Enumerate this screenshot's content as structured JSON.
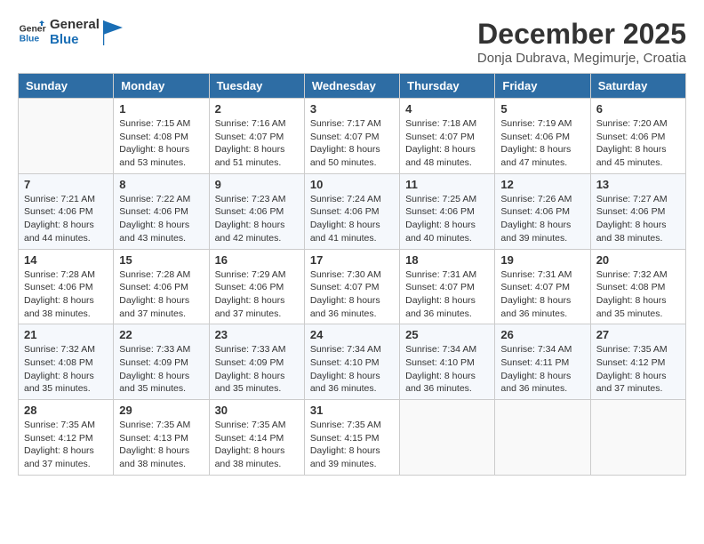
{
  "header": {
    "logo_general": "General",
    "logo_blue": "Blue",
    "month_year": "December 2025",
    "location": "Donja Dubrava, Megimurje, Croatia"
  },
  "weekdays": [
    "Sunday",
    "Monday",
    "Tuesday",
    "Wednesday",
    "Thursday",
    "Friday",
    "Saturday"
  ],
  "weeks": [
    [
      {
        "day": "",
        "sunrise": "",
        "sunset": "",
        "daylight": ""
      },
      {
        "day": "1",
        "sunrise": "7:15 AM",
        "sunset": "4:08 PM",
        "daylight": "8 hours and 53 minutes."
      },
      {
        "day": "2",
        "sunrise": "7:16 AM",
        "sunset": "4:07 PM",
        "daylight": "8 hours and 51 minutes."
      },
      {
        "day": "3",
        "sunrise": "7:17 AM",
        "sunset": "4:07 PM",
        "daylight": "8 hours and 50 minutes."
      },
      {
        "day": "4",
        "sunrise": "7:18 AM",
        "sunset": "4:07 PM",
        "daylight": "8 hours and 48 minutes."
      },
      {
        "day": "5",
        "sunrise": "7:19 AM",
        "sunset": "4:06 PM",
        "daylight": "8 hours and 47 minutes."
      },
      {
        "day": "6",
        "sunrise": "7:20 AM",
        "sunset": "4:06 PM",
        "daylight": "8 hours and 45 minutes."
      }
    ],
    [
      {
        "day": "7",
        "sunrise": "7:21 AM",
        "sunset": "4:06 PM",
        "daylight": "8 hours and 44 minutes."
      },
      {
        "day": "8",
        "sunrise": "7:22 AM",
        "sunset": "4:06 PM",
        "daylight": "8 hours and 43 minutes."
      },
      {
        "day": "9",
        "sunrise": "7:23 AM",
        "sunset": "4:06 PM",
        "daylight": "8 hours and 42 minutes."
      },
      {
        "day": "10",
        "sunrise": "7:24 AM",
        "sunset": "4:06 PM",
        "daylight": "8 hours and 41 minutes."
      },
      {
        "day": "11",
        "sunrise": "7:25 AM",
        "sunset": "4:06 PM",
        "daylight": "8 hours and 40 minutes."
      },
      {
        "day": "12",
        "sunrise": "7:26 AM",
        "sunset": "4:06 PM",
        "daylight": "8 hours and 39 minutes."
      },
      {
        "day": "13",
        "sunrise": "7:27 AM",
        "sunset": "4:06 PM",
        "daylight": "8 hours and 38 minutes."
      }
    ],
    [
      {
        "day": "14",
        "sunrise": "7:28 AM",
        "sunset": "4:06 PM",
        "daylight": "8 hours and 38 minutes."
      },
      {
        "day": "15",
        "sunrise": "7:28 AM",
        "sunset": "4:06 PM",
        "daylight": "8 hours and 37 minutes."
      },
      {
        "day": "16",
        "sunrise": "7:29 AM",
        "sunset": "4:06 PM",
        "daylight": "8 hours and 37 minutes."
      },
      {
        "day": "17",
        "sunrise": "7:30 AM",
        "sunset": "4:07 PM",
        "daylight": "8 hours and 36 minutes."
      },
      {
        "day": "18",
        "sunrise": "7:31 AM",
        "sunset": "4:07 PM",
        "daylight": "8 hours and 36 minutes."
      },
      {
        "day": "19",
        "sunrise": "7:31 AM",
        "sunset": "4:07 PM",
        "daylight": "8 hours and 36 minutes."
      },
      {
        "day": "20",
        "sunrise": "7:32 AM",
        "sunset": "4:08 PM",
        "daylight": "8 hours and 35 minutes."
      }
    ],
    [
      {
        "day": "21",
        "sunrise": "7:32 AM",
        "sunset": "4:08 PM",
        "daylight": "8 hours and 35 minutes."
      },
      {
        "day": "22",
        "sunrise": "7:33 AM",
        "sunset": "4:09 PM",
        "daylight": "8 hours and 35 minutes."
      },
      {
        "day": "23",
        "sunrise": "7:33 AM",
        "sunset": "4:09 PM",
        "daylight": "8 hours and 35 minutes."
      },
      {
        "day": "24",
        "sunrise": "7:34 AM",
        "sunset": "4:10 PM",
        "daylight": "8 hours and 36 minutes."
      },
      {
        "day": "25",
        "sunrise": "7:34 AM",
        "sunset": "4:10 PM",
        "daylight": "8 hours and 36 minutes."
      },
      {
        "day": "26",
        "sunrise": "7:34 AM",
        "sunset": "4:11 PM",
        "daylight": "8 hours and 36 minutes."
      },
      {
        "day": "27",
        "sunrise": "7:35 AM",
        "sunset": "4:12 PM",
        "daylight": "8 hours and 37 minutes."
      }
    ],
    [
      {
        "day": "28",
        "sunrise": "7:35 AM",
        "sunset": "4:12 PM",
        "daylight": "8 hours and 37 minutes."
      },
      {
        "day": "29",
        "sunrise": "7:35 AM",
        "sunset": "4:13 PM",
        "daylight": "8 hours and 38 minutes."
      },
      {
        "day": "30",
        "sunrise": "7:35 AM",
        "sunset": "4:14 PM",
        "daylight": "8 hours and 38 minutes."
      },
      {
        "day": "31",
        "sunrise": "7:35 AM",
        "sunset": "4:15 PM",
        "daylight": "8 hours and 39 minutes."
      },
      {
        "day": "",
        "sunrise": "",
        "sunset": "",
        "daylight": ""
      },
      {
        "day": "",
        "sunrise": "",
        "sunset": "",
        "daylight": ""
      },
      {
        "day": "",
        "sunrise": "",
        "sunset": "",
        "daylight": ""
      }
    ]
  ]
}
